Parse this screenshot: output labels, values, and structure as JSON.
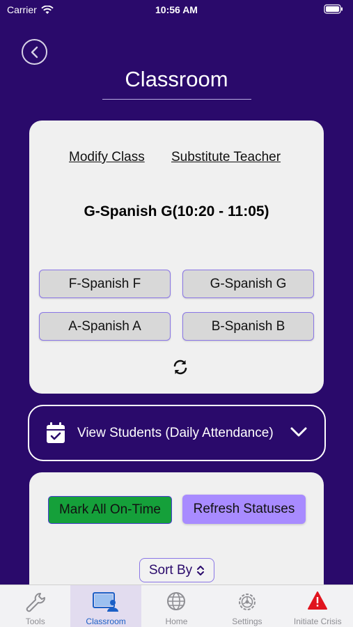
{
  "status_bar": {
    "carrier": "Carrier",
    "time": "10:56 AM"
  },
  "header": {
    "title": "Classroom"
  },
  "class_card": {
    "modify_class": "Modify Class",
    "substitute_teacher": "Substitute Teacher",
    "current_class": "G-Spanish G(10:20 - 11:05)",
    "class_buttons": [
      "F-Spanish F",
      "G-Spanish G",
      "A-Spanish A",
      "B-Spanish B"
    ]
  },
  "view_students": {
    "label": "View Students (Daily Attendance)"
  },
  "actions": {
    "mark_all_on_time": "Mark All On-Time",
    "refresh_statuses": "Refresh Statuses",
    "sort_by": "Sort By"
  },
  "tab_bar": {
    "tabs": [
      {
        "label": "Tools",
        "icon": "wrench-icon"
      },
      {
        "label": "Classroom",
        "icon": "classroom-icon",
        "active": true
      },
      {
        "label": "Home",
        "icon": "globe-icon"
      },
      {
        "label": "Settings",
        "icon": "gear-icon"
      },
      {
        "label": "Initiate Crisis",
        "icon": "warning-icon"
      }
    ]
  },
  "colors": {
    "background": "#2a0a6b",
    "mark_on_time": "#15a03a",
    "refresh_statuses": "#a88bff",
    "active_tab": "#1b5fc6",
    "crisis": "#e0141e"
  }
}
